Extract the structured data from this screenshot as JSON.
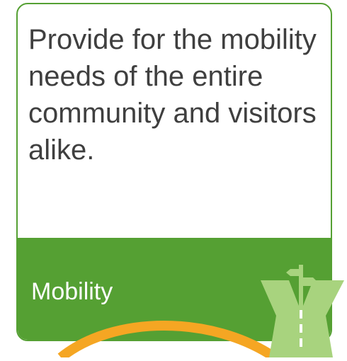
{
  "card": {
    "statement": "Provide for the mobility needs of the entire community and visitors alike.",
    "category": "Mobility",
    "icon": "road-signpost-icon"
  },
  "colors": {
    "accent_green": "#55a033",
    "light_green": "#a8d37e",
    "arc_orange": "#f5a623",
    "text_dark": "#3f3f3f",
    "text_light": "#ffffff"
  }
}
